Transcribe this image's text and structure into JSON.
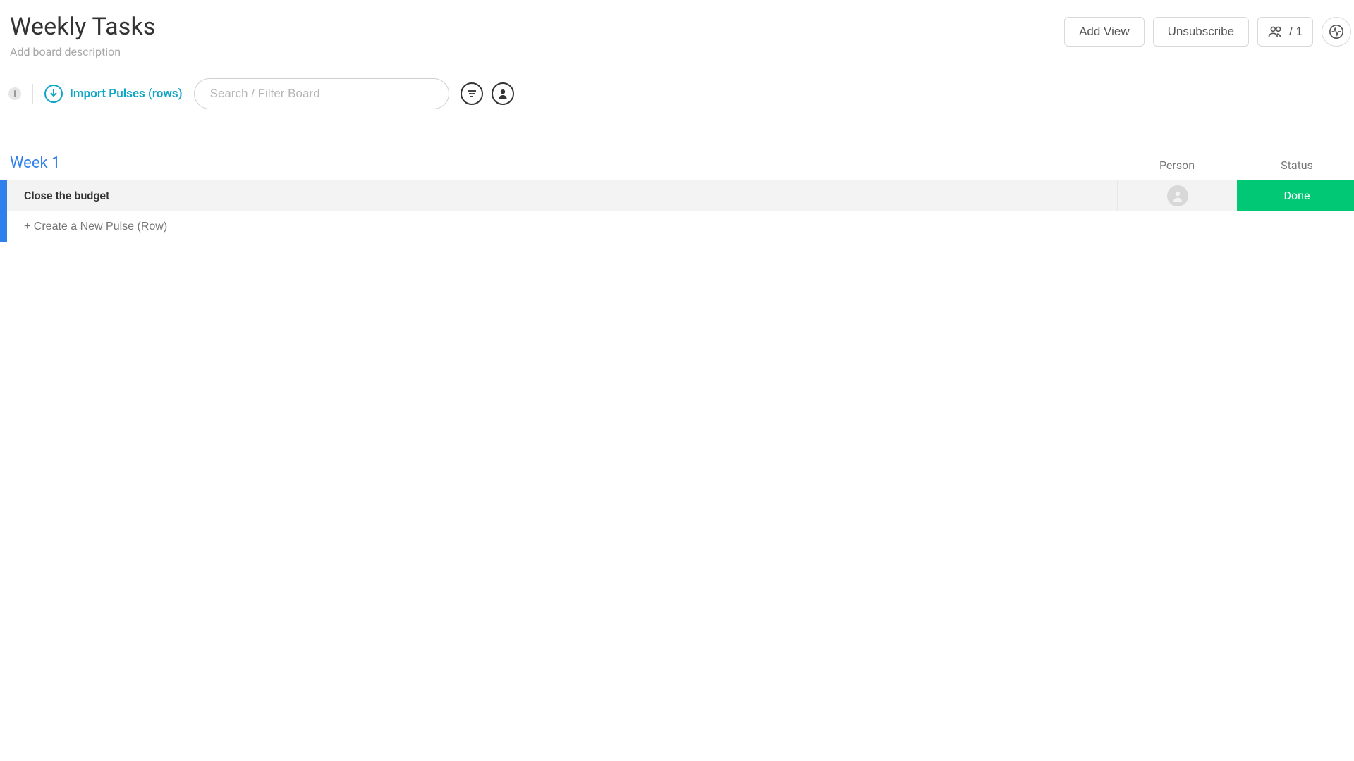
{
  "header": {
    "title": "Weekly Tasks",
    "description_placeholder": "Add board description",
    "add_view_label": "Add View",
    "unsubscribe_label": "Unsubscribe",
    "members_count": "/ 1"
  },
  "toolbar": {
    "import_label": "Import Pulses (rows)",
    "search_placeholder": "Search / Filter Board"
  },
  "group": {
    "name": "Week 1",
    "accent_color": "#2f80ed",
    "columns": {
      "person": "Person",
      "status": "Status"
    },
    "rows": [
      {
        "title": "Close the budget",
        "status_label": "Done",
        "status_color": "#00c875"
      }
    ],
    "new_row_placeholder": "+ Create a New Pulse (Row)"
  }
}
